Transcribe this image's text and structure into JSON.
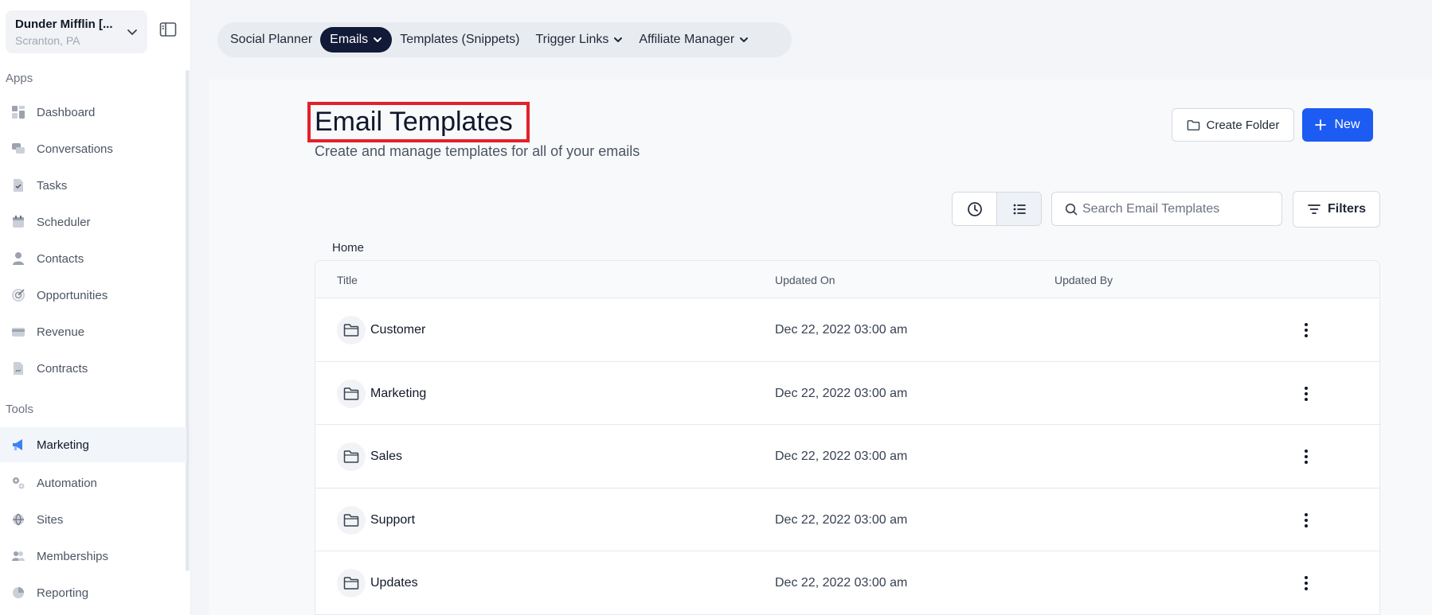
{
  "account": {
    "name": "Dunder Mifflin [...",
    "location": "Scranton, PA"
  },
  "sidebar": {
    "apps_label": "Apps",
    "tools_label": "Tools",
    "apps": [
      {
        "label": "Dashboard",
        "icon": "dashboard-icon"
      },
      {
        "label": "Conversations",
        "icon": "chat-icon"
      },
      {
        "label": "Tasks",
        "icon": "task-icon"
      },
      {
        "label": "Scheduler",
        "icon": "calendar-icon"
      },
      {
        "label": "Contacts",
        "icon": "person-icon"
      },
      {
        "label": "Opportunities",
        "icon": "target-icon"
      },
      {
        "label": "Revenue",
        "icon": "credit-card-icon"
      },
      {
        "label": "Contracts",
        "icon": "document-icon"
      }
    ],
    "tools": [
      {
        "label": "Marketing",
        "icon": "megaphone-icon",
        "active": true
      },
      {
        "label": "Automation",
        "icon": "gears-icon"
      },
      {
        "label": "Sites",
        "icon": "globe-icon"
      },
      {
        "label": "Memberships",
        "icon": "people-icon"
      },
      {
        "label": "Reporting",
        "icon": "pie-chart-icon"
      }
    ]
  },
  "tabs": [
    {
      "label": "Social Planner"
    },
    {
      "label": "Emails",
      "active": true,
      "dropdown": true
    },
    {
      "label": "Templates (Snippets)"
    },
    {
      "label": "Trigger Links",
      "dropdown": true
    },
    {
      "label": "Affiliate Manager",
      "dropdown": true
    }
  ],
  "page": {
    "title": "Email Templates",
    "subtitle": "Create and manage templates for all of your emails",
    "create_folder_label": "Create Folder",
    "new_label": "New",
    "search_placeholder": "Search Email Templates",
    "filters_label": "Filters",
    "breadcrumb": "Home",
    "highlight_color": "#e3202b",
    "accent_color": "#1d5cf2"
  },
  "table": {
    "columns": [
      "Title",
      "Updated On",
      "Updated By"
    ],
    "rows": [
      {
        "title": "Customer",
        "updated_on": "Dec 22, 2022 03:00 am",
        "updated_by": ""
      },
      {
        "title": "Marketing",
        "updated_on": "Dec 22, 2022 03:00 am",
        "updated_by": ""
      },
      {
        "title": "Sales",
        "updated_on": "Dec 22, 2022 03:00 am",
        "updated_by": ""
      },
      {
        "title": "Support",
        "updated_on": "Dec 22, 2022 03:00 am",
        "updated_by": ""
      },
      {
        "title": "Updates",
        "updated_on": "Dec 22, 2022 03:00 am",
        "updated_by": ""
      }
    ]
  }
}
